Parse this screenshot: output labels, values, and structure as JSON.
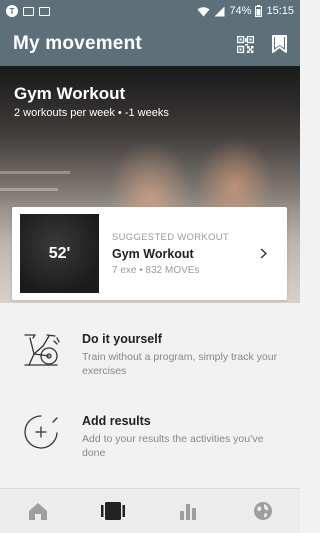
{
  "status_bar": {
    "left_icons": [
      "t-circle-icon",
      "image-icon",
      "calendar-icon"
    ],
    "battery": "74%",
    "time": "15:15"
  },
  "app_bar": {
    "title": "My movement",
    "actions": [
      "qr-code-icon",
      "bookmark-icon"
    ]
  },
  "hero": {
    "title": "Gym Workout",
    "subtitle": "2 workouts per week • -1 weeks"
  },
  "suggested": {
    "thumbnail_text": "52'",
    "label": "SUGGESTED WORKOUT",
    "title": "Gym Workout",
    "meta": "7 exe • 832 MOVEs"
  },
  "list": [
    {
      "title": "Do it yourself",
      "description": "Train without a program, simply track your exercises",
      "icon": "exercise-bike-icon"
    },
    {
      "title": "Add results",
      "description": "Add to your results the activities you’ve done",
      "icon": "add-circle-icon"
    }
  ],
  "bottom_nav": {
    "items": [
      {
        "name": "home",
        "icon": "home-icon",
        "active": false
      },
      {
        "name": "movement",
        "icon": "workout-icon",
        "active": true
      },
      {
        "name": "stats",
        "icon": "bar-chart-icon",
        "active": false
      },
      {
        "name": "world",
        "icon": "globe-icon",
        "active": false
      }
    ]
  },
  "colors": {
    "app_bar": "#5d7079",
    "active_nav": "#222222",
    "inactive_nav": "#9e9e9e"
  }
}
